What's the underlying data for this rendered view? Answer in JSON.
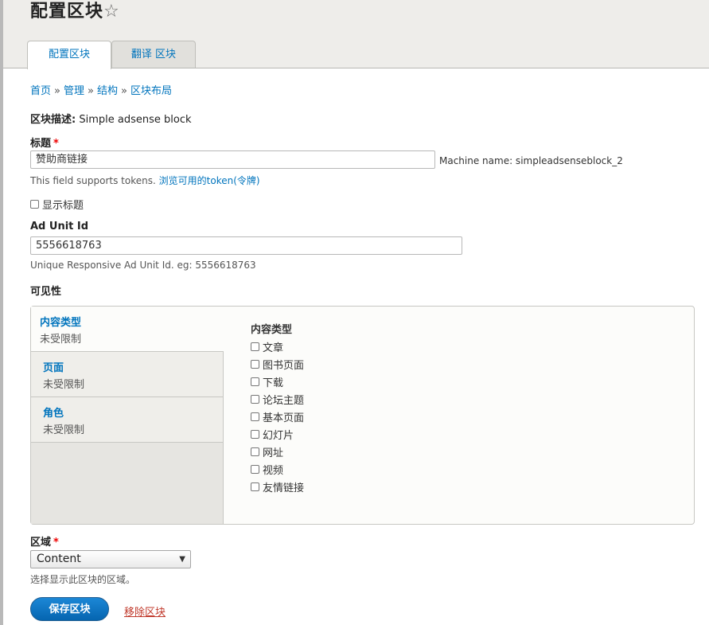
{
  "header": {
    "title": "配置区块",
    "tabs": [
      {
        "label": "配置区块"
      },
      {
        "label": "翻译 区块"
      }
    ]
  },
  "breadcrumb": {
    "items": [
      "首页",
      "管理",
      "结构",
      "区块布局"
    ],
    "separator": "»"
  },
  "block_description": {
    "label": "区块描述:",
    "value": "Simple adsense block"
  },
  "title_field": {
    "label": "标题",
    "required_mark": "*",
    "value": "赞助商链接",
    "machine_name": "Machine name: simpleadsenseblock_2",
    "help_text": "This field supports tokens.",
    "help_link": "浏览可用的token(令牌)"
  },
  "display_title": {
    "label": "显示标题"
  },
  "ad_unit": {
    "label": "Ad Unit Id",
    "value": "5556618763",
    "help_text": "Unique Responsive Ad Unit Id. eg: 5556618763"
  },
  "visibility": {
    "label": "可见性",
    "tabs": [
      {
        "title": "内容类型",
        "summary": "未受限制"
      },
      {
        "title": "页面",
        "summary": "未受限制"
      },
      {
        "title": "角色",
        "summary": "未受限制"
      }
    ],
    "pane_title": "内容类型",
    "options": [
      "文章",
      "图书页面",
      "下载",
      "论坛主题",
      "基本页面",
      "幻灯片",
      "网址",
      "视频",
      "友情链接"
    ]
  },
  "region": {
    "label": "区域",
    "required_mark": "*",
    "selected": "Content",
    "help_text": "选择显示此区块的区域。"
  },
  "actions": {
    "save_label": "保存区块",
    "remove_label": "移除区块"
  },
  "icons": {
    "star": "star-outline-icon",
    "dropdown": "triangle-down-icon"
  },
  "colors": {
    "link": "#0074bd",
    "primary_button": "#0a76c4",
    "required": "#e00000",
    "remove_link": "#c0392b"
  }
}
